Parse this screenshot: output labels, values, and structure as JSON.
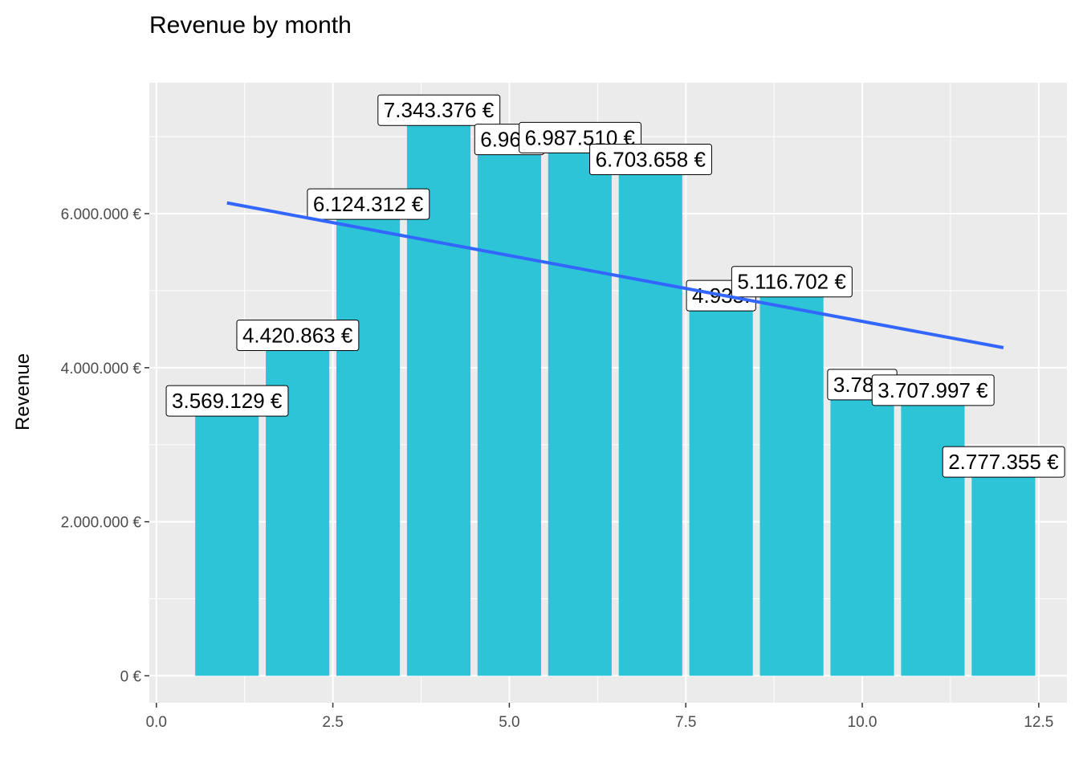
{
  "chart_data": {
    "type": "bar",
    "title": "Revenue by month",
    "xlabel": "",
    "ylabel": "Revenue",
    "x": [
      1,
      2,
      3,
      4,
      5,
      6,
      7,
      8,
      9,
      10,
      11,
      12
    ],
    "values": [
      3569129,
      4420863,
      6124312,
      7343376,
      6963000,
      6987510,
      6703658,
      4935200,
      5116702,
      3781000,
      3707997,
      2777355
    ],
    "data_labels": [
      "3.569.129 €",
      "4.420.863 €",
      "6.124.312 €",
      "7.343.376 €",
      "6.963.",
      "6.987.510 €",
      "6.703.658 €",
      "4.935.",
      "5.116.702 €",
      "3.781.",
      "3.707.997 €",
      "2.777.355 €"
    ],
    "x_ticks": [
      0,
      2.5,
      5,
      7.5,
      10,
      12.5
    ],
    "x_tick_labels": [
      "0.0",
      "2.5",
      "5.0",
      "7.5",
      "10.0",
      "12.5"
    ],
    "y_ticks": [
      0,
      2000000,
      4000000,
      6000000
    ],
    "y_tick_labels": [
      "0 €",
      "2.000.000 €",
      "4.000.000 €",
      "6.000.000 €"
    ],
    "xlim": [
      -0.1,
      12.9
    ],
    "ylim": [
      -350000,
      7700000
    ],
    "trend_line": {
      "x": [
        1,
        12
      ],
      "y": [
        6140000,
        4260000
      ]
    },
    "grid": true,
    "colors": {
      "bar": "#2CC4D6",
      "trend": "#3366FF",
      "panel": "#EBEBEB",
      "grid": "#FFFFFF"
    }
  }
}
